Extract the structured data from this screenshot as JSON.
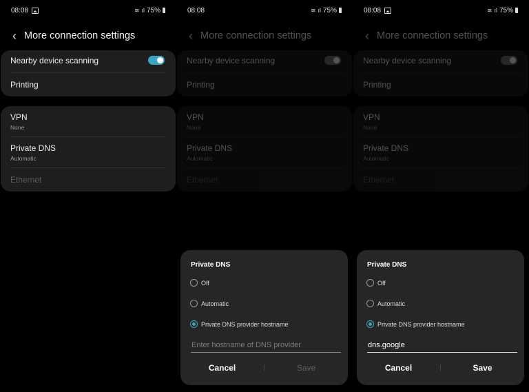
{
  "status_bar": {
    "time": "08:08",
    "battery": "75%"
  },
  "page": {
    "title": "More connection settings",
    "rows": {
      "nearby": "Nearby device scanning",
      "printing": "Printing",
      "vpn": "VPN",
      "vpn_sub": "None",
      "dns": "Private DNS",
      "dns_sub": "Automatic",
      "ethernet": "Ethernet"
    },
    "nearby_toggle_on": true
  },
  "dialog": {
    "title": "Private DNS",
    "options": [
      "Off",
      "Automatic",
      "Private DNS provider hostname"
    ],
    "selected": "Private DNS provider hostname",
    "placeholder": "Enter hostname of DNS provider",
    "value": "dns.google",
    "cancel": "Cancel",
    "save": "Save"
  },
  "colors": {
    "accent": "#3ba5c8",
    "card": "#1e1e1e",
    "sheet": "#262626",
    "background": "#000000"
  },
  "icons": [
    "gallery-icon",
    "wifi-icon",
    "signal-icon",
    "battery-icon",
    "back-arrow-icon"
  ]
}
